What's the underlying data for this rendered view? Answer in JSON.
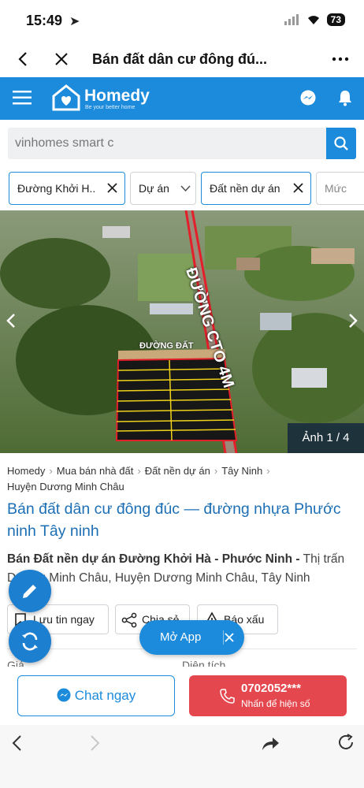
{
  "status": {
    "time": "15:49",
    "battery": "73"
  },
  "browser": {
    "title": "Bán đất dân cư đông đú...",
    "back_icon": "chevron-left-icon",
    "close_icon": "close-icon",
    "more_icon": "more-icon"
  },
  "header": {
    "logo": "Homedy",
    "tagline": "Be your better home"
  },
  "search": {
    "value": "vinhomes smart c"
  },
  "filters": [
    {
      "label": "Đường Khởi H..",
      "removable": true
    },
    {
      "label": "Dự án",
      "dropdown": true
    },
    {
      "label": "Đất nền dự án",
      "removable": true
    },
    {
      "label": "Mức"
    }
  ],
  "hero": {
    "road_label": "ĐƯỜNG CTO 4M",
    "inner_road_label": "ĐƯỜNG ĐẤT",
    "counter": "Ảnh 1 / 4"
  },
  "breadcrumb": [
    "Homedy",
    "Mua bán nhà đất",
    "Đất nền dự án",
    "Tây Ninh",
    "Huyện Dương Minh Châu"
  ],
  "listing": {
    "title": "Bán đất dân cư đông đúc — đường nhựa Phước ninh Tây ninh",
    "address_bold": "Bán Đất nền dự án Đường Khởi Hà - Phước Ninh -",
    "address_rest": " Thị trấn Dương Minh Châu, Huyện Dương Minh Châu, Tây Ninh"
  },
  "actions": {
    "save": "Lưu tin ngay",
    "share": "Chia sẻ",
    "report": "Báo xấu"
  },
  "open_app": "Mở App",
  "info_labels": {
    "price": "Giá",
    "area": "Diện tích"
  },
  "contact": {
    "chat": "Chat ngay",
    "phone": "0702052***",
    "phone_hint": "Nhấn để hiện số"
  },
  "colors": {
    "brand": "#1c8bdc",
    "phone_button": "#e5474f",
    "title": "#1c6fb5"
  }
}
